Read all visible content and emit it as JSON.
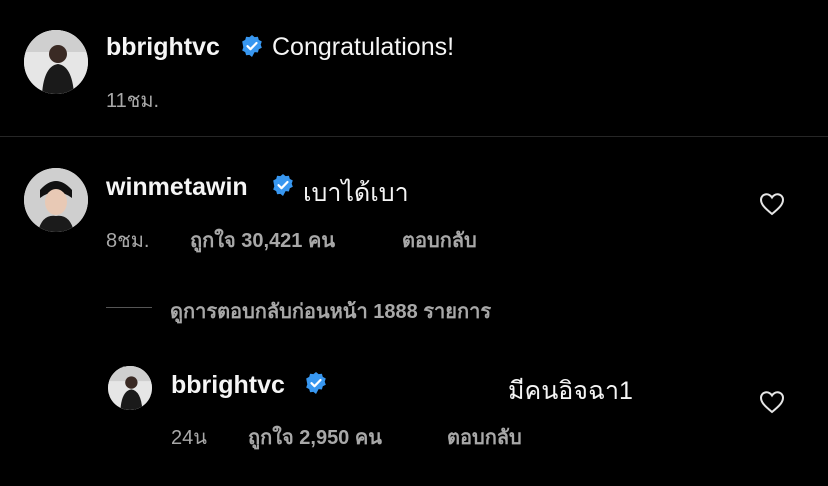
{
  "caption": {
    "username": "bbrightvc",
    "text": "Congratulations!",
    "time": "11ชม."
  },
  "comment": {
    "username": "winmetawin",
    "text": "เบาได้เบา",
    "time": "8ชม.",
    "likes": "ถูกใจ 30,421 คน",
    "reply_label": "ตอบกลับ"
  },
  "view_replies": "ดูการตอบกลับก่อนหน้า 1888 รายการ",
  "reply": {
    "username": "bbrightvc",
    "text": "มีคนอิจฉา1",
    "time": "24น",
    "likes": "ถูกใจ 2,950 คน",
    "reply_label": "ตอบกลับ"
  },
  "colors": {
    "background": "#000000",
    "verified": "#3897f0",
    "secondary_text": "#a8a8a8",
    "divider": "#262626"
  },
  "icons": [
    "verified-badge-icon",
    "heart-icon"
  ]
}
